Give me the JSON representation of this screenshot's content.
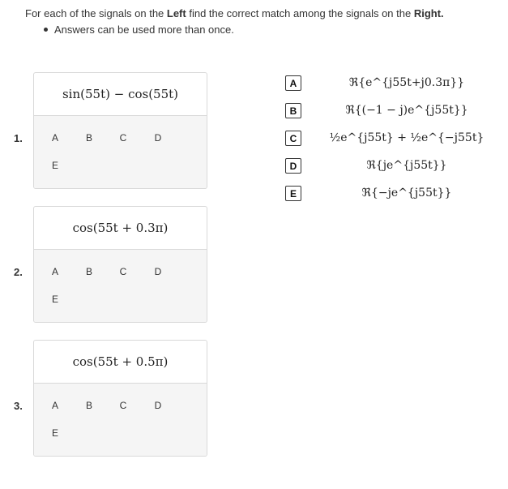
{
  "instructions": {
    "prefix": "For each of the signals on the ",
    "left_word": "Left",
    "middle": " find the correct match among the signals on the ",
    "right_word": "Right.",
    "bullet": "Answers can be used more than once."
  },
  "questions": [
    {
      "number": "1.",
      "expression": "sin(55t) − cos(55t)",
      "options": [
        "A",
        "B",
        "C",
        "D",
        "E"
      ]
    },
    {
      "number": "2.",
      "expression": "cos(55t + 0.3π)",
      "options": [
        "A",
        "B",
        "C",
        "D",
        "E"
      ]
    },
    {
      "number": "3.",
      "expression": "cos(55t + 0.5π)",
      "options": [
        "A",
        "B",
        "C",
        "D",
        "E"
      ]
    }
  ],
  "answers": [
    {
      "label": "A",
      "expression": "ℜ{e^{j55t+j0.3π}}"
    },
    {
      "label": "B",
      "expression": "ℜ{(−1 − j)e^{j55t}}"
    },
    {
      "label": "C",
      "expression": "½e^{j55t} + ½e^{−j55t}"
    },
    {
      "label": "D",
      "expression": "ℜ{je^{j55t}}"
    },
    {
      "label": "E",
      "expression": "ℜ{−je^{j55t}}"
    }
  ]
}
